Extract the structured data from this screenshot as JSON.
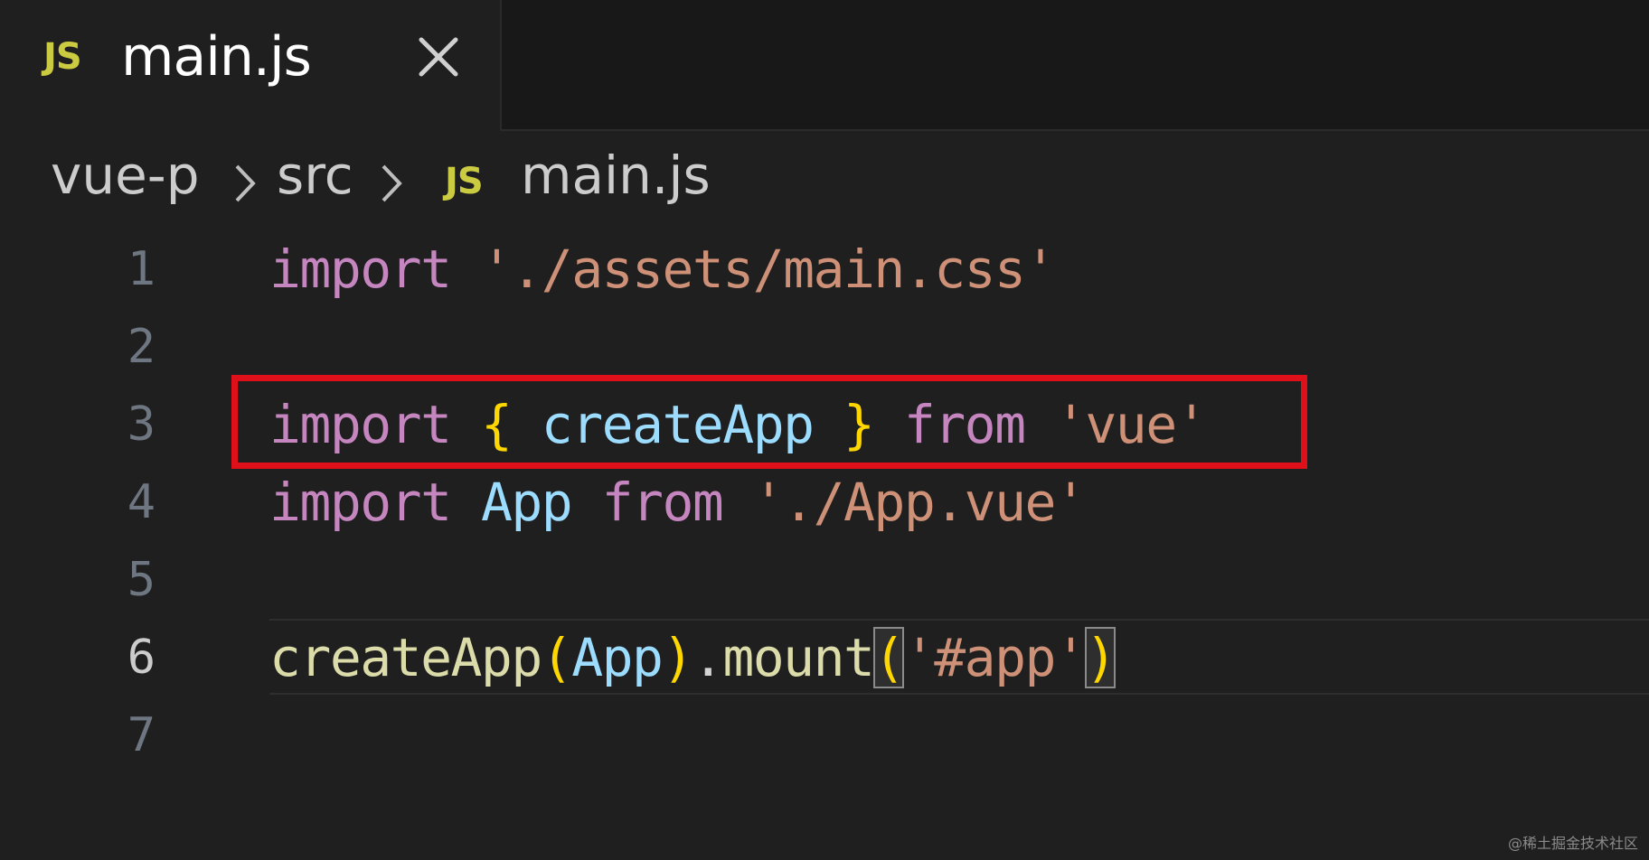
{
  "tab": {
    "icon_label": "JS",
    "title": "main.js",
    "close_icon": "close-icon"
  },
  "breadcrumb": {
    "items": [
      "vue-p",
      "src",
      "main.js"
    ],
    "file_icon_label": "JS"
  },
  "editor": {
    "line_numbers": [
      "1",
      "2",
      "3",
      "4",
      "5",
      "6",
      "7"
    ],
    "active_line": "6",
    "lines": {
      "l1": {
        "kw": "import",
        "str": "'./assets/main.css'"
      },
      "l3": {
        "kw": "import",
        "open": "{",
        "name": "createApp",
        "close": "}",
        "from": "from",
        "str": "'vue'"
      },
      "l4": {
        "kw": "import",
        "name": "App",
        "from": "from",
        "str": "'./App.vue'"
      },
      "l6": {
        "fn": "createApp",
        "p1": "(",
        "arg": "App",
        "p2": ")",
        "dot": ".",
        "method": "mount",
        "p3": "(",
        "str": "'#app'",
        "p4": ")"
      }
    }
  },
  "colors": {
    "keyword": "#c586c0",
    "string": "#ce9178",
    "function": "#dcdcaa",
    "variable": "#9cdcfe",
    "bracket": "#ffd700",
    "highlight_box": "#e0101a"
  },
  "watermark": "@稀土掘金技术社区"
}
